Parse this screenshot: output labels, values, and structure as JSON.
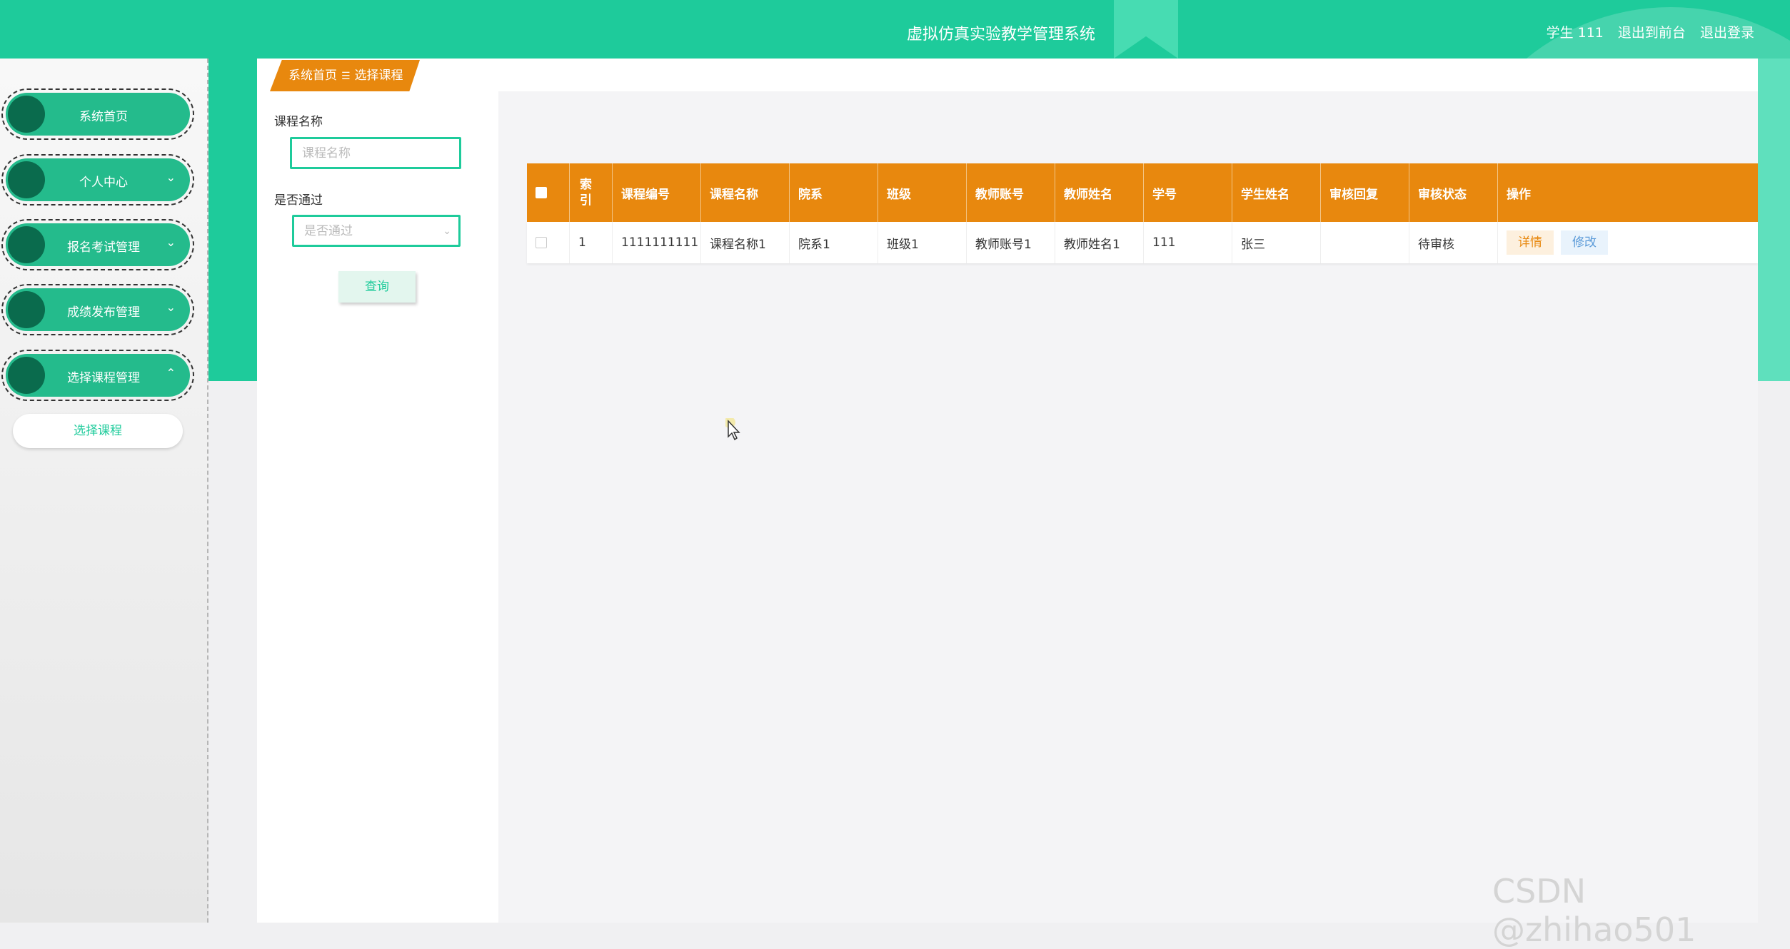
{
  "header": {
    "title": "虚拟仿真实验教学管理系统",
    "user_info": "学生 111",
    "back_to_front": "退出到前台",
    "logout": "退出登录"
  },
  "sidebar": {
    "items": [
      {
        "label": "系统首页",
        "chevron": ""
      },
      {
        "label": "个人中心",
        "chevron": "⌄"
      },
      {
        "label": "报名考试管理",
        "chevron": "⌄"
      },
      {
        "label": "成绩发布管理",
        "chevron": "⌄"
      },
      {
        "label": "选择课程管理",
        "chevron": "⌃"
      }
    ],
    "submenu": [
      "选择课程"
    ]
  },
  "breadcrumb": {
    "home": "系统首页",
    "separator": "☰",
    "current": "选择课程"
  },
  "search": {
    "course_name_label": "课程名称",
    "course_name_placeholder": "课程名称",
    "passed_label": "是否通过",
    "passed_placeholder": "是否通过",
    "query_button": "查询"
  },
  "table": {
    "headers": [
      "",
      "索引",
      "课程编号",
      "课程名称",
      "院系",
      "班级",
      "教师账号",
      "教师姓名",
      "学号",
      "学生姓名",
      "审核回复",
      "审核状态",
      "操作"
    ],
    "rows": [
      [
        "",
        "1",
        "1111111111",
        "课程名称1",
        "院系1",
        "班级1",
        "教师账号1",
        "教师姓名1",
        "111",
        "张三",
        "",
        "待审核",
        ""
      ]
    ],
    "actions": {
      "detail": "详情",
      "edit": "修改"
    }
  },
  "watermark": "CSDN @zhihao501",
  "colors": {
    "primary": "#1ecb9b",
    "accent": "#e8880e",
    "dark_circle": "#0a6b4d"
  }
}
